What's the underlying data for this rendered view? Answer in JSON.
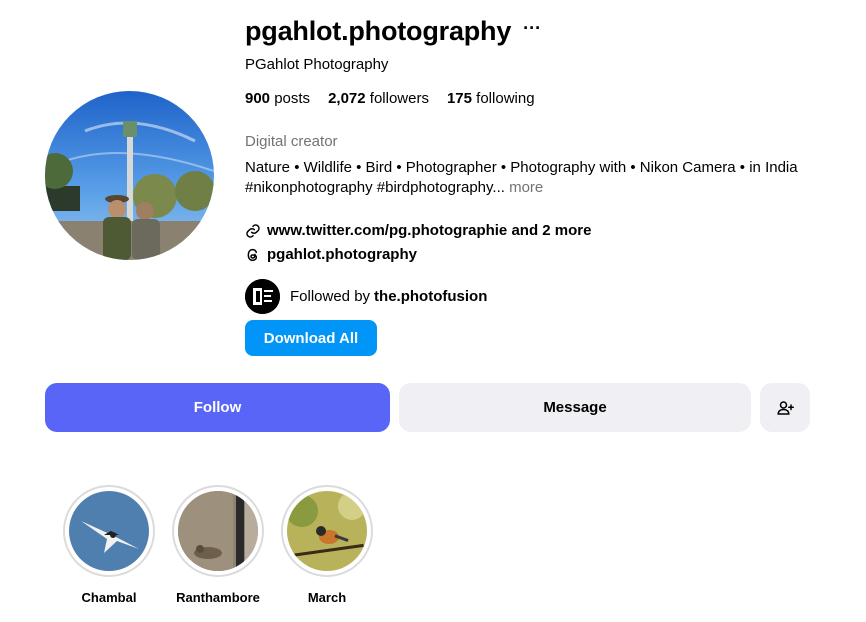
{
  "profile": {
    "username": "pgahlot.photography",
    "full_name": "PGahlot Photography",
    "more_options": "···",
    "stats": {
      "posts_count": "900",
      "posts_label": "posts",
      "followers_count": "2,072",
      "followers_label": "followers",
      "following_count": "175",
      "following_label": "following"
    },
    "category": "Digital creator",
    "bio_line1": "Nature • Wildlife • Bird • Photographer • Photography with • Nikon Camera • in India",
    "bio_line2": "#nikonphotography #birdphotography...",
    "bio_more": "more",
    "link_text": "www.twitter.com/pg.photographie and 2 more",
    "threads_text": "pgahlot.photography",
    "followed_by_prefix": "Followed by",
    "followed_by_user": "the.photofusion"
  },
  "buttons": {
    "download_all": "Download All",
    "follow": "Follow",
    "message": "Message"
  },
  "highlights": [
    {
      "label": "Chambal"
    },
    {
      "label": "Ranthambore"
    },
    {
      "label": "March"
    }
  ],
  "icons": [
    "more-options-icon",
    "link-icon",
    "threads-icon",
    "add-user-icon"
  ],
  "colors": {
    "download_button": "#0095f6",
    "follow_button": "#5865f6",
    "secondary_button": "#efeff4",
    "muted_text": "#737373"
  }
}
